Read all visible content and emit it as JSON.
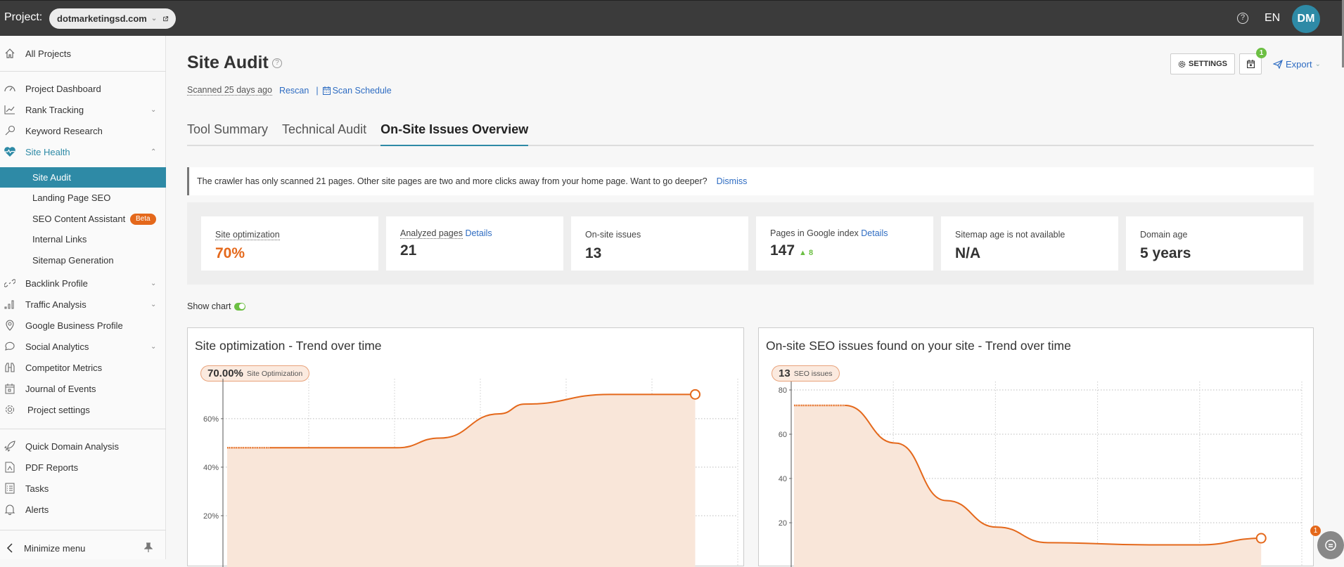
{
  "topbar": {
    "project_label": "Project:",
    "project_name": "dotmarketingsd.com",
    "language": "EN",
    "avatar_initials": "DM"
  },
  "sidebar": {
    "all_projects": "All Projects",
    "items": [
      {
        "label": "Project Dashboard",
        "icon": "dashboard-icon"
      },
      {
        "label": "Rank Tracking",
        "icon": "chart-line-icon",
        "expandable": true
      },
      {
        "label": "Keyword Research",
        "icon": "key-icon"
      },
      {
        "label": "Site Health",
        "icon": "heart-pulse-icon",
        "expandable": true,
        "expanded": true
      },
      {
        "label": "Backlink Profile",
        "icon": "link-icon",
        "expandable": true
      },
      {
        "label": "Traffic Analysis",
        "icon": "bar-chart-icon",
        "expandable": true
      },
      {
        "label": "Google Business Profile",
        "icon": "map-pin-icon"
      },
      {
        "label": "Social Analytics",
        "icon": "speech-bubble-icon",
        "expandable": true
      },
      {
        "label": "Competitor Metrics",
        "icon": "binoculars-icon"
      },
      {
        "label": "Journal of Events",
        "icon": "calendar-icon"
      },
      {
        "label": "Project settings",
        "icon": "gear-icon"
      }
    ],
    "site_health_sub": [
      {
        "label": "Site Audit",
        "active": true
      },
      {
        "label": "Landing Page SEO"
      },
      {
        "label": "SEO Content Assistant",
        "badge": "Beta"
      },
      {
        "label": "Internal Links"
      },
      {
        "label": "Sitemap Generation"
      }
    ],
    "tools": [
      {
        "label": "Quick Domain Analysis",
        "icon": "rocket-icon"
      },
      {
        "label": "PDF Reports",
        "icon": "pdf-icon"
      },
      {
        "label": "Tasks",
        "icon": "tasks-icon"
      },
      {
        "label": "Alerts",
        "icon": "bell-icon"
      }
    ],
    "minimize": "Minimize menu"
  },
  "header": {
    "title": "Site Audit",
    "scanned": "Scanned 25 days ago",
    "rescan": "Rescan",
    "separator": "|",
    "scan_schedule": "Scan Schedule",
    "settings_label": "SETTINGS",
    "calendar_badge": "1",
    "export_label": "Export"
  },
  "tabs": [
    {
      "label": "Tool Summary",
      "active": false
    },
    {
      "label": "Technical Audit",
      "active": false
    },
    {
      "label": "On-Site Issues Overview",
      "active": true
    }
  ],
  "notice": {
    "text": "The crawler has only scanned 21 pages. Other site pages are two and more clicks away from your home page. Want to go deeper?",
    "dismiss": "Dismiss"
  },
  "stats": [
    {
      "label": "Site optimization",
      "value": "70%",
      "accent": "#e4681b"
    },
    {
      "label": "Analyzed pages",
      "link": "Details",
      "value": "21"
    },
    {
      "label": "On-site issues",
      "value": "13"
    },
    {
      "label": "Pages in Google index",
      "link": "Details",
      "value": "147",
      "delta": "8"
    },
    {
      "label": "Sitemap age is not available",
      "value": "N/A"
    },
    {
      "label": "Domain age",
      "value": "5 years"
    }
  ],
  "show_chart": {
    "label": "Show chart",
    "on": true
  },
  "chat": {
    "badge": "1"
  },
  "chart_data": [
    {
      "type": "area",
      "title": "Site optimization - Trend over time",
      "pill_value": "70.00%",
      "pill_label": "Site Optimization",
      "ylim": [
        0,
        73
      ],
      "yticks": [
        20,
        40,
        60
      ],
      "ytick_labels": [
        "20%",
        "40%",
        "60%"
      ],
      "xlabel": "",
      "ylabel": "",
      "grid": true,
      "x_points": [
        0,
        0.5,
        1.5,
        2.0,
        2.5,
        3.2,
        3.5,
        4.5,
        5.5
      ],
      "values": [
        48,
        48,
        48,
        48,
        52,
        62,
        66,
        70,
        70
      ],
      "dotted_until": 0.5,
      "x_range": [
        0,
        6
      ],
      "last_point_marker": true,
      "color": "#e4681b"
    },
    {
      "type": "area",
      "title": "On-site SEO issues found on your site - Trend over time",
      "pill_value": "13",
      "pill_label": "SEO issues",
      "ylim": [
        0,
        80
      ],
      "yticks": [
        20,
        40,
        60,
        80
      ],
      "ytick_labels": [
        "20",
        "40",
        "60",
        "80"
      ],
      "xlabel": "",
      "ylabel": "",
      "grid": true,
      "x_points": [
        0,
        0.5,
        1.0,
        1.5,
        2.0,
        2.5,
        3.5,
        4.0,
        4.6
      ],
      "values": [
        73,
        73,
        56,
        30,
        18,
        11,
        10,
        10,
        13
      ],
      "dotted_until": 0.5,
      "x_range": [
        0,
        5
      ],
      "last_point_marker": true,
      "color": "#e4681b"
    }
  ]
}
